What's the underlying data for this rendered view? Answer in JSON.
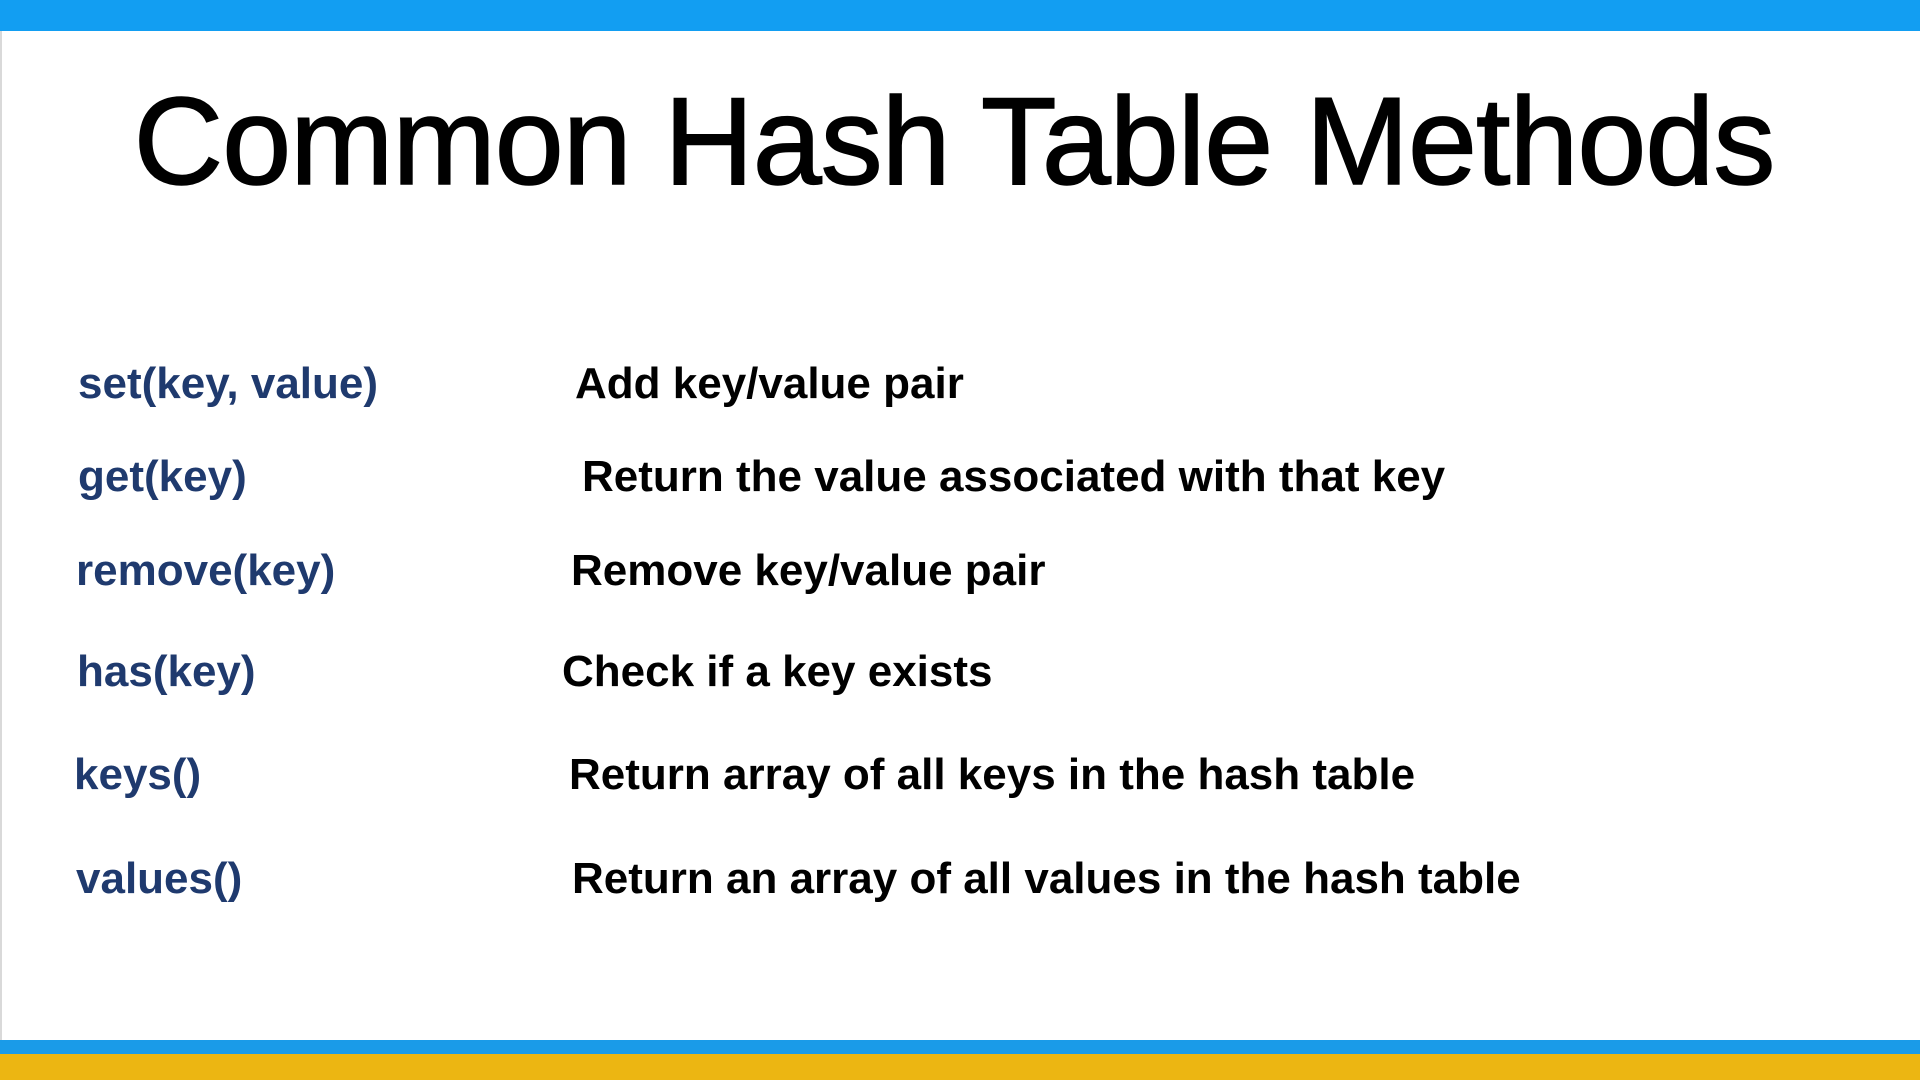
{
  "slide": {
    "title": "Common Hash Table Methods",
    "colors": {
      "top_bar": "#129ef2",
      "bottom_blue": "#1a9be8",
      "bottom_yellow": "#ecb612",
      "method_text": "#1f3a6e",
      "description_text": "#000000"
    },
    "methods": [
      {
        "name": "set(key, value)",
        "description": "Add key/value pair"
      },
      {
        "name": "get(key)",
        "description": "Return the value associated with that key"
      },
      {
        "name": "remove(key)",
        "description": "Remove key/value pair"
      },
      {
        "name": "has(key)",
        "description": "Check if a key exists"
      },
      {
        "name": "keys()",
        "description": "Return array of all keys in the hash table"
      },
      {
        "name": "values()",
        "description": "Return an array of all values in the hash table"
      }
    ]
  }
}
